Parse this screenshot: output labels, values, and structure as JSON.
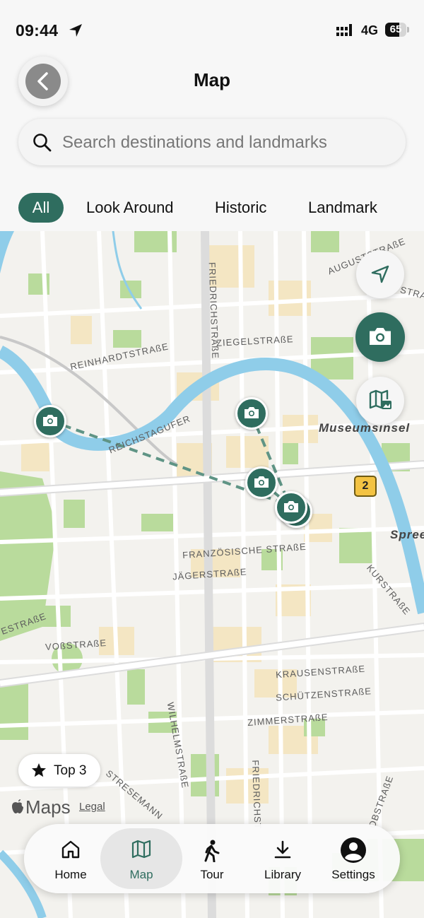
{
  "status_bar": {
    "time": "09:44",
    "network": "4G",
    "battery": "65",
    "battery_level": 0.65
  },
  "header": {
    "title": "Map"
  },
  "search": {
    "placeholder": "Search destinations and landmarks"
  },
  "filters": [
    {
      "label": "All",
      "active": true
    },
    {
      "label": "Look Around",
      "active": false
    },
    {
      "label": "Historic",
      "active": false
    },
    {
      "label": "Landmark",
      "active": false
    }
  ],
  "map": {
    "streets": {
      "augustsstrasse": "AUGUSTSTRAßE",
      "strasse_edge": "STRA",
      "friedrichstrasse_n": "FRIEDRICHSTRAßE",
      "ziegelstrasse": "ZIEGELSTRAßE",
      "reinhardtstrasse": "REINHARDTSTRAßE",
      "reichstagufer": "REICHSTAGUFER",
      "franzoesische": "FRANZÖSISCHE STRAßE",
      "jaegerstrasse": "JÄGERSTRAßE",
      "kurstrasse": "KURSTRAßE",
      "estrasse": "ESTRAßE",
      "vossstrasse": "VOßSTRAßE",
      "krausenstrasse": "KRAUSENSTRAßE",
      "schuetzenstrasse": "SCHÜTZENSTRAßE",
      "zimmerstrasse": "ZIMMERSTRAßE",
      "wilhelmstrasse": "WILHELMSTRAßE",
      "stresemann": "STRESEMANN",
      "friedrichstrasse_s": "FRIEDRICHST",
      "obstrasse": "OBSTRAßE"
    },
    "places": {
      "museumsinsel": "Museumsinsel",
      "spree": "Spree"
    },
    "route_badge": "2",
    "top3_label": "Top 3",
    "attribution": {
      "maps": "Maps",
      "legal": "Legal"
    },
    "colors": {
      "water": "#8fcde9",
      "park": "#b9db9c",
      "buildings": "#f4e6c3",
      "marker": "#2f6d5f"
    }
  },
  "tabbar": [
    {
      "label": "Home",
      "icon": "home-icon",
      "active": false
    },
    {
      "label": "Map",
      "icon": "map-icon",
      "active": true
    },
    {
      "label": "Tour",
      "icon": "walk-icon",
      "active": false
    },
    {
      "label": "Library",
      "icon": "download-icon",
      "active": false
    },
    {
      "label": "Settings",
      "icon": "person-icon",
      "active": false
    }
  ]
}
